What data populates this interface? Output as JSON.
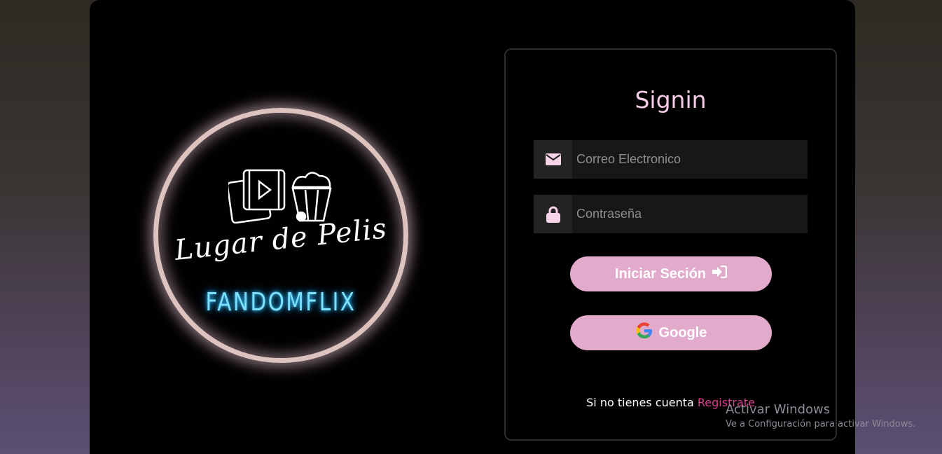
{
  "logo": {
    "script_text": "Lugar de Pelis",
    "brand_text": "FANDOMFLIX",
    "icons": [
      "film-play-icon",
      "popcorn-icon"
    ],
    "ring_color": "#dcc3c0",
    "brand_color": "#7ee0ff"
  },
  "form": {
    "title": "Signin",
    "email": {
      "placeholder": "Correo Electronico",
      "value": "",
      "icon": "envelope-icon"
    },
    "password": {
      "placeholder": "Contraseña",
      "value": "",
      "icon": "lock-icon"
    },
    "login_button": {
      "label": "Iniciar Seción",
      "icon": "sign-in-arrow-icon"
    },
    "google_button": {
      "label": "Google",
      "icon": "google-logo-icon"
    },
    "signup_prompt": "Si no tienes cuenta ",
    "signup_link": "Registrate"
  },
  "colors": {
    "accent_pink": "#e2aacb",
    "title_pink": "#f6cde6",
    "link_pink": "#d63f8b"
  },
  "watermark": {
    "title": "Activar Windows",
    "subtitle": "Ve a Configuración para activar Windows."
  }
}
